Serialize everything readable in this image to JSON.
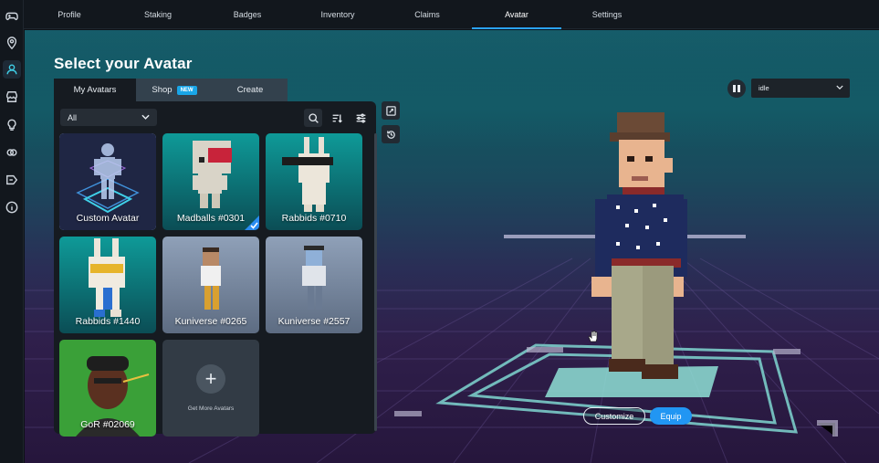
{
  "sidebar": {
    "icons": [
      "gamepad-icon",
      "location-pin-icon",
      "user-icon",
      "store-icon",
      "lightbulb-icon",
      "link-icon",
      "tag-icon",
      "info-icon"
    ],
    "active_index": 2
  },
  "topnav": {
    "tabs": [
      {
        "label": "Profile"
      },
      {
        "label": "Staking"
      },
      {
        "label": "Badges"
      },
      {
        "label": "Inventory"
      },
      {
        "label": "Claims"
      },
      {
        "label": "Avatar"
      },
      {
        "label": "Settings"
      }
    ],
    "active": "Avatar",
    "accent_color": "#2aa3ff"
  },
  "page": {
    "title": "Select your Avatar"
  },
  "panel_tabs": [
    {
      "label": "My Avatars",
      "active": true
    },
    {
      "label": "Shop",
      "badge": "NEW"
    },
    {
      "label": "Create"
    }
  ],
  "filter": {
    "selected": "All"
  },
  "avatars": [
    {
      "name": "Custom Avatar",
      "selected": true
    },
    {
      "name": "Madballs #0301",
      "equipped": true
    },
    {
      "name": "Rabbids #0710"
    },
    {
      "name": "Rabbids #1440"
    },
    {
      "name": "Kuniverse #0265"
    },
    {
      "name": "Kuniverse #2557"
    },
    {
      "name": "GoR #02069"
    }
  ],
  "get_more": {
    "label": "Get More Avatars"
  },
  "animation": {
    "selected": "idle"
  },
  "actions": {
    "customize": "Customize",
    "equip": "Equip"
  },
  "colors": {
    "equip_button": "#2196f3",
    "new_badge": "#19a6e8",
    "scene_top": "#0f4451",
    "scene_bottom": "#26163c"
  }
}
